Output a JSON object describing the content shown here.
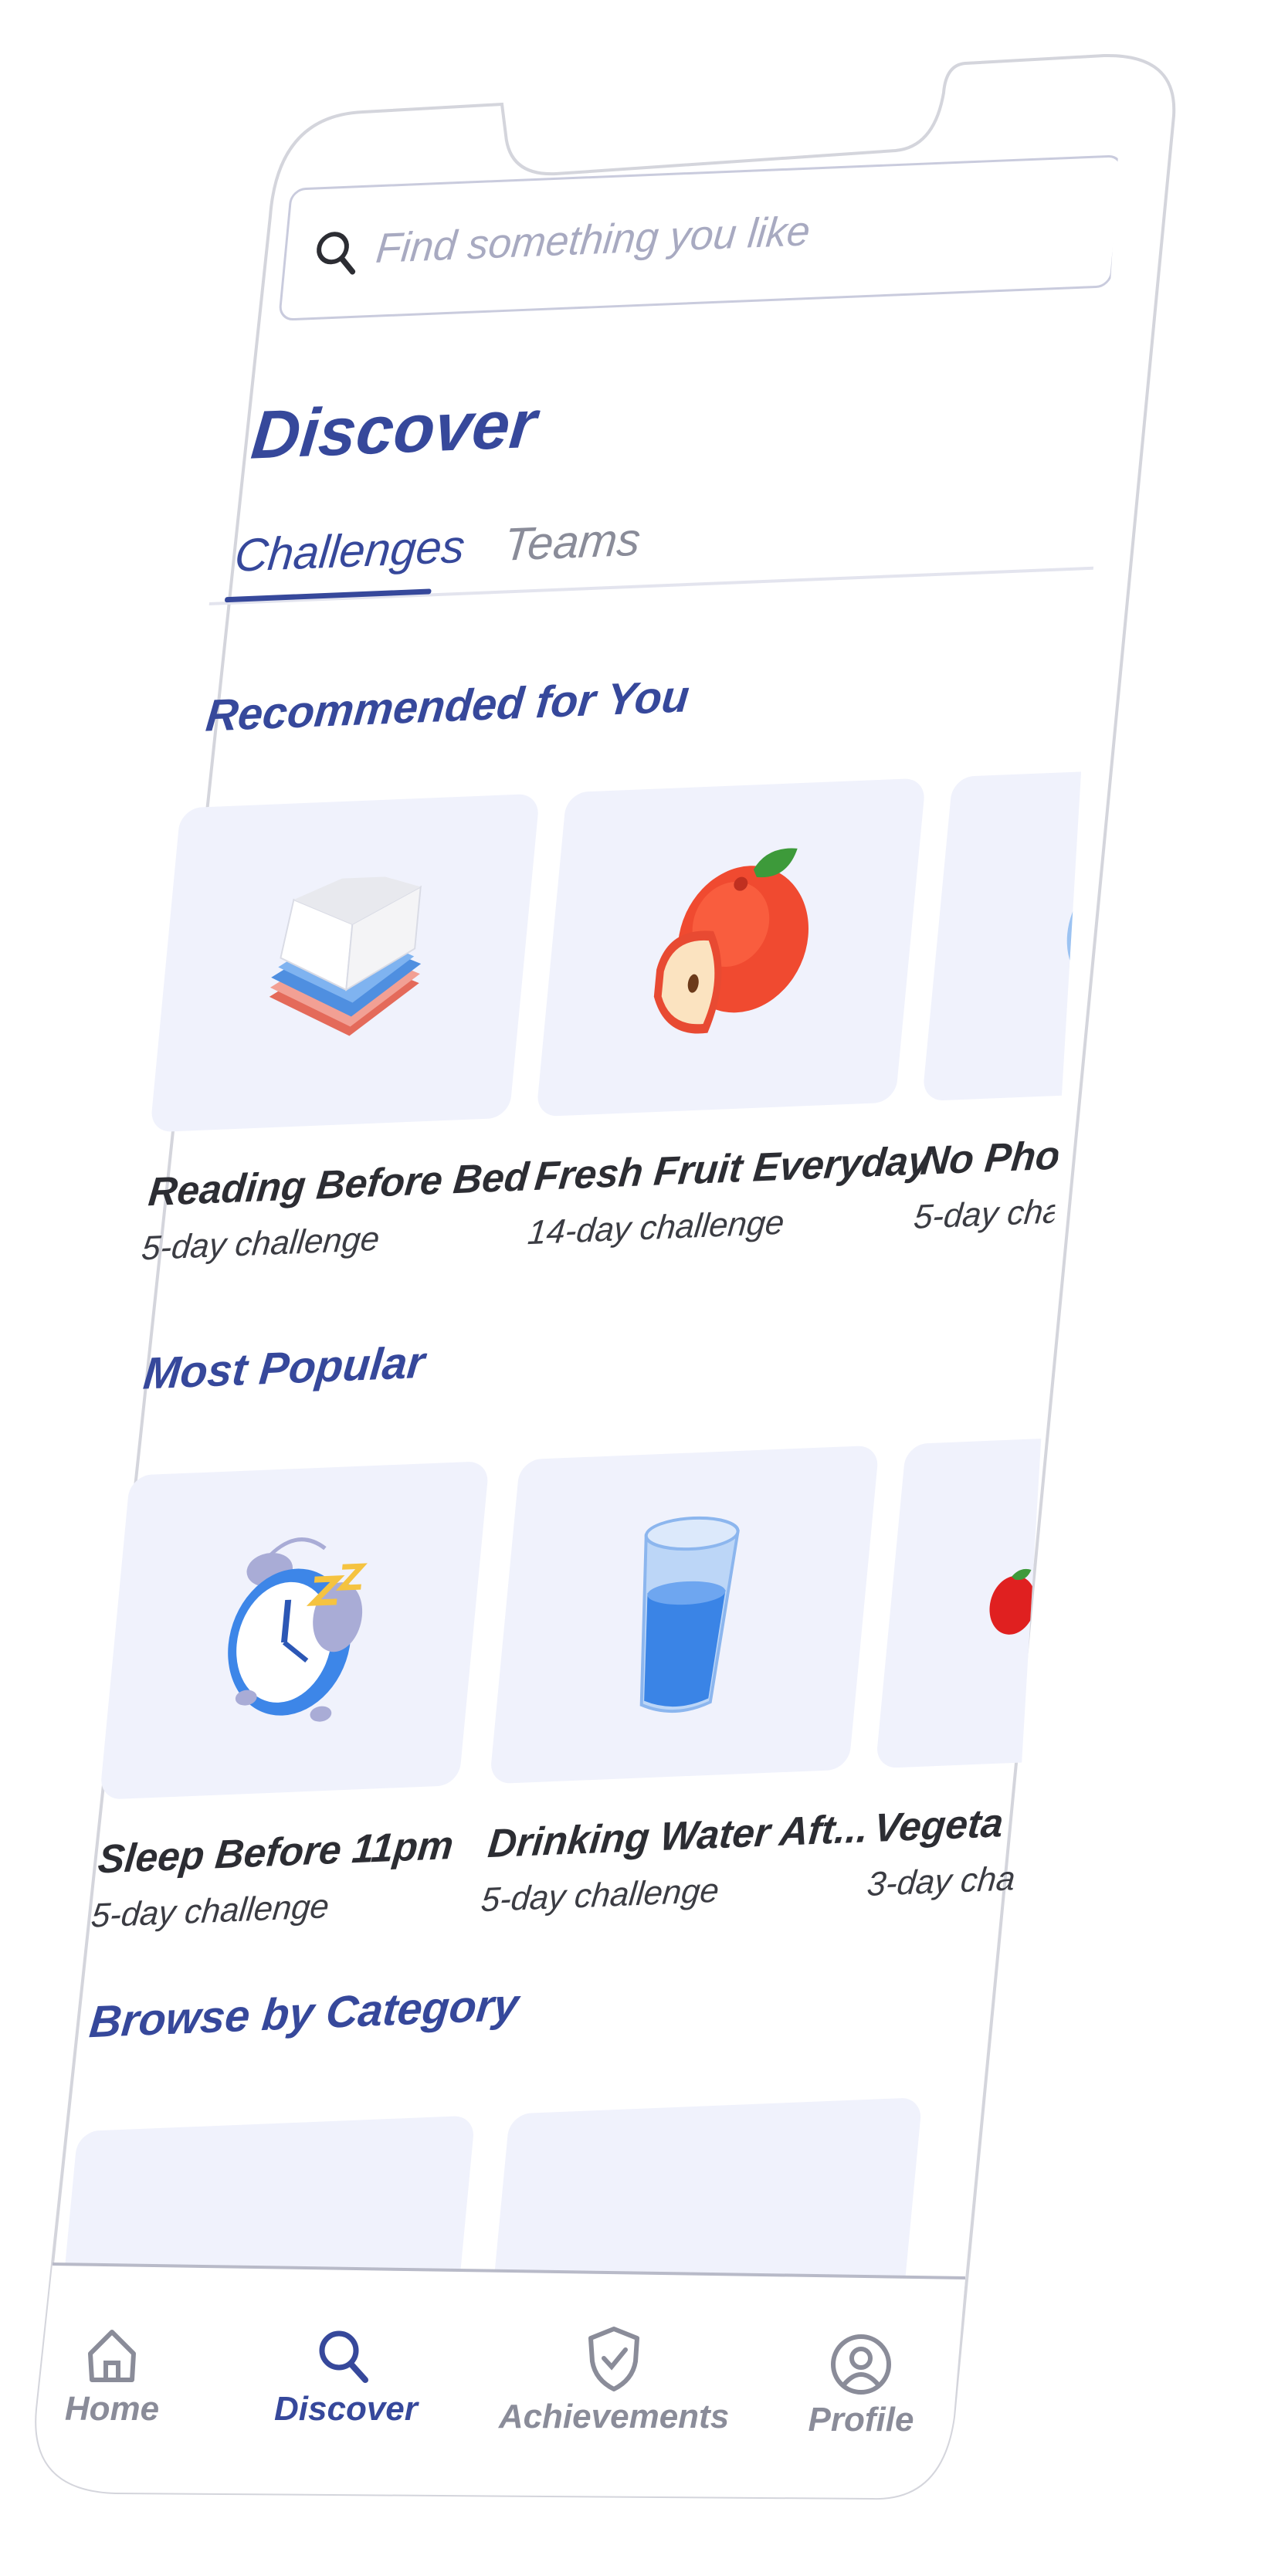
{
  "search": {
    "placeholder": "Find something you like"
  },
  "page": {
    "title": "Discover"
  },
  "tabs": [
    {
      "label": "Challenges",
      "active": true
    },
    {
      "label": "Teams",
      "active": false
    }
  ],
  "recommended": {
    "title": "Recommended for You",
    "cards": [
      {
        "title": "Reading Before Bed",
        "subtitle": "5-day challenge",
        "icon": "books-icon"
      },
      {
        "title": "Fresh Fruit Everyday",
        "subtitle": "14-day challenge",
        "icon": "apple-icon"
      },
      {
        "title": "No Pho",
        "subtitle": "5-day cha",
        "icon": "phone-icon"
      }
    ]
  },
  "popular": {
    "title": "Most Popular",
    "cards": [
      {
        "title": "Sleep Before 11pm",
        "subtitle": "5-day challenge",
        "icon": "alarm-clock-icon"
      },
      {
        "title": "Drinking Water Aft...",
        "subtitle": "5-day challenge",
        "icon": "water-glass-icon"
      },
      {
        "title": "Vegeta",
        "subtitle": "3-day cha",
        "icon": "vegetable-icon"
      }
    ]
  },
  "categories": {
    "title": "Browse by Category"
  },
  "nav": {
    "items": [
      {
        "label": "Home",
        "icon": "home-icon",
        "active": false
      },
      {
        "label": "Discover",
        "icon": "search-icon",
        "active": true
      },
      {
        "label": "Achievements",
        "icon": "shield-check-icon",
        "active": false
      },
      {
        "label": "Profile",
        "icon": "profile-icon",
        "active": false
      }
    ]
  },
  "colors": {
    "accent": "#36489b",
    "tile": "#f0f2fc",
    "muted": "#8a8c99",
    "outline": "#d4d5dc"
  }
}
